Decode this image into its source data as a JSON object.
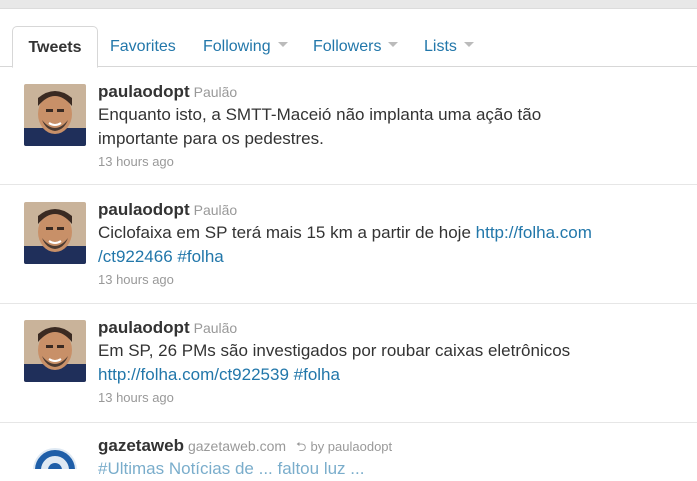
{
  "tabs": [
    {
      "label": "Tweets"
    },
    {
      "label": "Favorites"
    },
    {
      "label": "Following"
    },
    {
      "label": "Followers"
    },
    {
      "label": "Lists"
    }
  ],
  "tweets": [
    {
      "username": "paulaodopt",
      "fullname": "Paulão",
      "text_line1": "Enquanto isto, a SMTT-Maceió não implanta uma ação tão",
      "text_line2": "importante para os pedestres.",
      "time": "13 hours ago"
    },
    {
      "username": "paulaodopt",
      "fullname": "Paulão",
      "text_line1_plain": "Ciclofaixa em SP terá mais 15 km a partir de hoje ",
      "text_line1_link": "http://folha.com",
      "text_line2_link": "/ct922466",
      "text_line2_hashtag": "#folha",
      "time": "13 hours ago"
    },
    {
      "username": "paulaodopt",
      "fullname": "Paulão",
      "text_line1": "Em SP, 26 PMs são investigados por roubar caixas eletrônicos",
      "text_line2_link": "http://folha.com/ct922539",
      "text_line2_hashtag": "#folha",
      "time": "13 hours ago"
    },
    {
      "username": "gazetaweb",
      "fullname": "gazetaweb.com",
      "retweet_by": "by paulaodopt",
      "text_partial": "#Ultimas Notícias de ... faltou luz ..."
    }
  ],
  "colors": {
    "link": "#2277aa",
    "muted": "#999999",
    "text": "#333333"
  }
}
